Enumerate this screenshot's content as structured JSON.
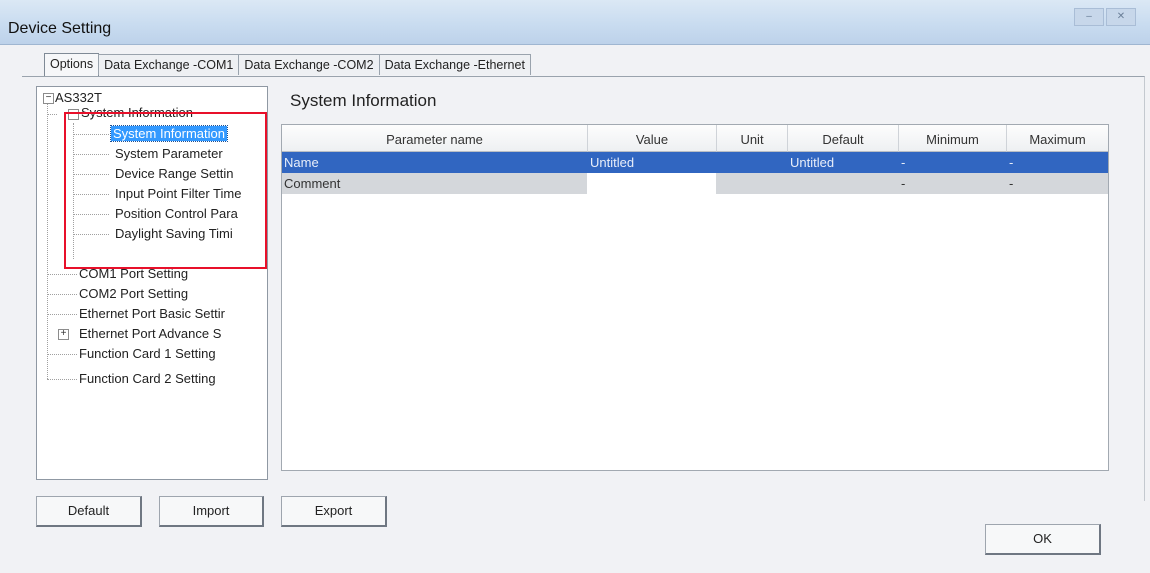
{
  "window": {
    "title": "Device Setting"
  },
  "tabs": [
    {
      "label": "Options",
      "active": true
    },
    {
      "label": "Data Exchange -COM1"
    },
    {
      "label": "Data Exchange -COM2"
    },
    {
      "label": "Data Exchange -Ethernet"
    }
  ],
  "tree": {
    "root": "AS332T",
    "system_information": "System Information",
    "children": [
      "System Information",
      "System Parameter",
      "Device Range Settin",
      "Input Point Filter Time",
      "Position Control Para",
      "Daylight Saving Timi"
    ],
    "others": [
      "COM1 Port Setting",
      "COM2 Port Setting",
      "Ethernet Port Basic Settir",
      "Ethernet Port Advance S",
      "Function Card 1 Setting",
      "Function Card 2 Setting"
    ],
    "expand_minus": "−",
    "expand_plus": "+"
  },
  "panel": {
    "title": "System Information"
  },
  "grid": {
    "headers": [
      "Parameter name",
      "Value",
      "Unit",
      "Default",
      "Minimum",
      "Maximum"
    ],
    "rows": [
      {
        "name": "Name",
        "value": "Untitled",
        "unit": "",
        "default": "Untitled",
        "minimum": "-",
        "maximum": "-"
      },
      {
        "name": "Comment",
        "value": "",
        "unit": "",
        "default": "",
        "minimum": "-",
        "maximum": "-"
      }
    ]
  },
  "buttons": {
    "default": "Default",
    "import": "Import",
    "export": "Export",
    "ok": "OK"
  },
  "colors": {
    "selection": "#3166c1",
    "highlight_box": "#e8102a",
    "tree_selection": "#3399ff"
  }
}
